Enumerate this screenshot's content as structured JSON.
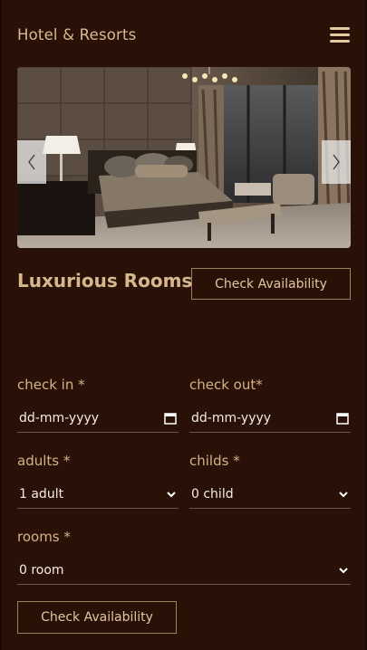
{
  "header": {
    "brand": "Hotel & Resorts",
    "menu_icon": "hamburger-menu-icon"
  },
  "slider": {
    "prev_icon": "chevron-left-icon",
    "next_icon": "chevron-right-icon",
    "image": "luxurious-bedroom-photo"
  },
  "section": {
    "title": "Luxurious Rooms",
    "top_button": "Check Availability"
  },
  "form": {
    "check_in": {
      "label": "check in *",
      "value": "dd-mm-yyyy",
      "icon": "calendar-icon"
    },
    "check_out": {
      "label": "check out*",
      "value": "dd-mm-yyyy",
      "icon": "calendar-icon"
    },
    "adults": {
      "label": "adults *",
      "value": "1 adult",
      "icon": "chevron-down-icon"
    },
    "childs": {
      "label": "childs *",
      "value": "0 child",
      "icon": "chevron-down-icon"
    },
    "rooms": {
      "label": "rooms *",
      "value": "0 room",
      "icon": "chevron-down-icon"
    },
    "submit": "Check Availability"
  },
  "colors": {
    "background": "#2a1107",
    "accent_text": "#d7b78c",
    "border": "#9c8161"
  }
}
